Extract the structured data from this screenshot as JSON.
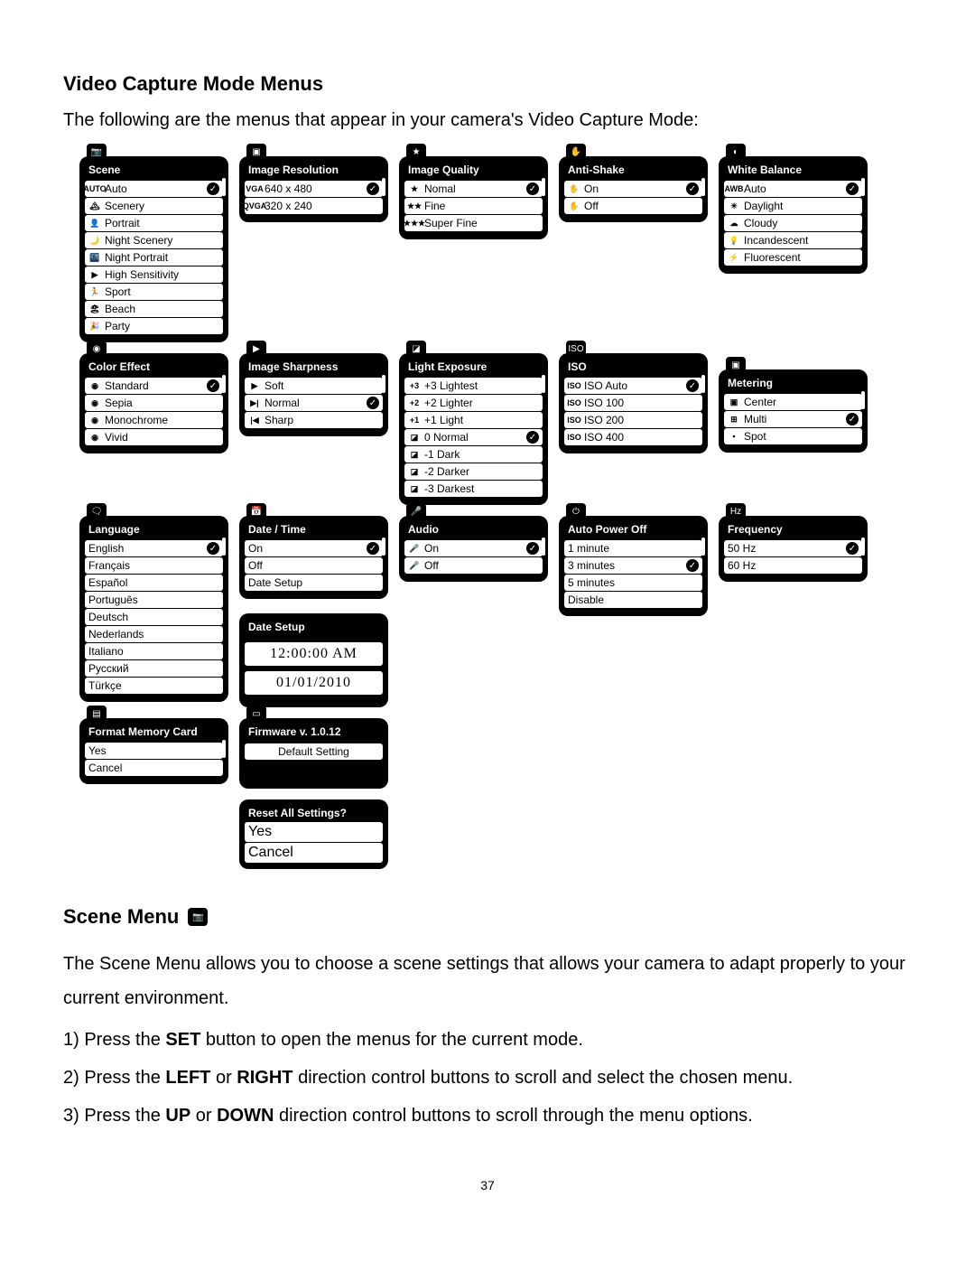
{
  "heading": "Video Capture Mode Menus",
  "intro": "The following are the menus that appear in your camera's Video Capture Mode:",
  "menus": {
    "scene": {
      "title": "Scene",
      "items": [
        {
          "icon": "AUTO",
          "label": "Auto",
          "checked": true
        },
        {
          "icon": "🏔",
          "label": "Scenery"
        },
        {
          "icon": "👤",
          "label": "Portrait"
        },
        {
          "icon": "🌙",
          "label": "Night Scenery"
        },
        {
          "icon": "🌃",
          "label": "Night Portrait"
        },
        {
          "icon": "▶",
          "label": "High Sensitivity"
        },
        {
          "icon": "🏃",
          "label": "Sport"
        },
        {
          "icon": "🏖",
          "label": "Beach"
        },
        {
          "icon": "🎉",
          "label": "Party"
        }
      ]
    },
    "resolution": {
      "title": "Image Resolution",
      "items": [
        {
          "icon": "VGA",
          "label": "640 x 480",
          "checked": true
        },
        {
          "icon": "QVGA",
          "label": "320 x 240"
        }
      ]
    },
    "quality": {
      "title": "Image Quality",
      "items": [
        {
          "icon": "★",
          "label": "Nomal",
          "checked": true
        },
        {
          "icon": "★★",
          "label": "Fine"
        },
        {
          "icon": "★★★",
          "label": "Super Fine"
        }
      ]
    },
    "antishake": {
      "title": "Anti-Shake",
      "items": [
        {
          "icon": "✋",
          "label": "On",
          "checked": true
        },
        {
          "icon": "✋",
          "label": "Off"
        }
      ]
    },
    "whitebalance": {
      "title": "White Balance",
      "items": [
        {
          "icon": "AWB",
          "label": "Auto",
          "checked": true
        },
        {
          "icon": "☀",
          "label": "Daylight"
        },
        {
          "icon": "☁",
          "label": "Cloudy"
        },
        {
          "icon": "💡",
          "label": "Incandescent"
        },
        {
          "icon": "⚡",
          "label": "Fluorescent"
        }
      ]
    },
    "coloreffect": {
      "title": "Color Effect",
      "items": [
        {
          "icon": "◉",
          "label": "Standard",
          "checked": true
        },
        {
          "icon": "◉",
          "label": "Sepia"
        },
        {
          "icon": "◉",
          "label": "Monochrome"
        },
        {
          "icon": "◉",
          "label": "Vivid"
        }
      ]
    },
    "sharpness": {
      "title": "Image Sharpness",
      "items": [
        {
          "icon": "▶",
          "label": "Soft"
        },
        {
          "icon": "▶|",
          "label": "Normal",
          "checked": true
        },
        {
          "icon": "|◀",
          "label": "Sharp"
        }
      ]
    },
    "exposure": {
      "title": "Light Exposure",
      "items": [
        {
          "icon": "+3",
          "label": "+3 Lightest"
        },
        {
          "icon": "+2",
          "label": "+2 Lighter"
        },
        {
          "icon": "+1",
          "label": "+1 Light"
        },
        {
          "icon": "◪",
          "label": "0 Normal",
          "checked": true
        },
        {
          "icon": "◪",
          "label": "-1 Dark"
        },
        {
          "icon": "◪",
          "label": "-2 Darker"
        },
        {
          "icon": "◪",
          "label": "-3 Darkest"
        }
      ]
    },
    "iso": {
      "title": "ISO",
      "items": [
        {
          "icon": "ISO",
          "label": "ISO Auto",
          "checked": true
        },
        {
          "icon": "ISO",
          "label": "ISO 100"
        },
        {
          "icon": "ISO",
          "label": "ISO 200"
        },
        {
          "icon": "ISO",
          "label": "ISO 400"
        }
      ]
    },
    "metering": {
      "title": "Metering",
      "items": [
        {
          "icon": "▣",
          "label": "Center"
        },
        {
          "icon": "⊞",
          "label": "Multi",
          "checked": true
        },
        {
          "icon": "▪",
          "label": "Spot"
        }
      ]
    },
    "language": {
      "title": "Language",
      "items": [
        {
          "label": "English",
          "checked": true
        },
        {
          "label": "Français"
        },
        {
          "label": "Español"
        },
        {
          "label": "Português"
        },
        {
          "label": "Deutsch"
        },
        {
          "label": "Nederlands"
        },
        {
          "label": "Italiano"
        },
        {
          "label": "Русский"
        },
        {
          "label": "Türkçe"
        }
      ]
    },
    "datetime": {
      "title": "Date / Time",
      "items": [
        {
          "label": "On",
          "checked": true
        },
        {
          "label": "Off"
        },
        {
          "label": "Date Setup"
        }
      ]
    },
    "datesetup": {
      "title": "Date Setup",
      "time": "12:00:00 AM",
      "date": "01/01/2010"
    },
    "audio": {
      "title": "Audio",
      "items": [
        {
          "icon": "🎤",
          "label": "On",
          "checked": true
        },
        {
          "icon": "🎤",
          "label": "Off"
        }
      ]
    },
    "autopower": {
      "title": "Auto Power Off",
      "items": [
        {
          "label": "1 minute"
        },
        {
          "label": "3 minutes",
          "checked": true
        },
        {
          "label": "5 minutes"
        },
        {
          "label": "Disable"
        }
      ]
    },
    "frequency": {
      "title": "Frequency",
      "items": [
        {
          "label": "50 Hz",
          "checked": true
        },
        {
          "label": "60 Hz"
        }
      ]
    },
    "format": {
      "title": "Format Memory Card",
      "items": [
        {
          "label": "Yes"
        },
        {
          "label": "Cancel"
        }
      ]
    },
    "firmware": {
      "title": "Firmware v. 1.0.12",
      "default_label": "Default Setting"
    },
    "reset": {
      "title": "Reset All Settings?",
      "items": [
        {
          "label": "Yes"
        },
        {
          "label": "Cancel"
        }
      ]
    }
  },
  "scene_heading": "Scene Menu",
  "scene_para": "The Scene Menu allows you to choose a scene settings that allows your camera to adapt properly to your current environment.",
  "steps": {
    "s1a": "1)  Press the ",
    "s1b": "SET",
    "s1c": " button to open the menus for the current mode.",
    "s2a": "2)  Press the ",
    "s2b": "LEFT",
    "s2c": " or ",
    "s2d": "RIGHT",
    "s2e": " direction control buttons to scroll and select the chosen menu.",
    "s3a": "3)  Press the ",
    "s3b": "UP",
    "s3c": " or ",
    "s3d": "DOWN",
    "s3e": " direction control buttons to scroll through the menu options."
  },
  "page": "37"
}
